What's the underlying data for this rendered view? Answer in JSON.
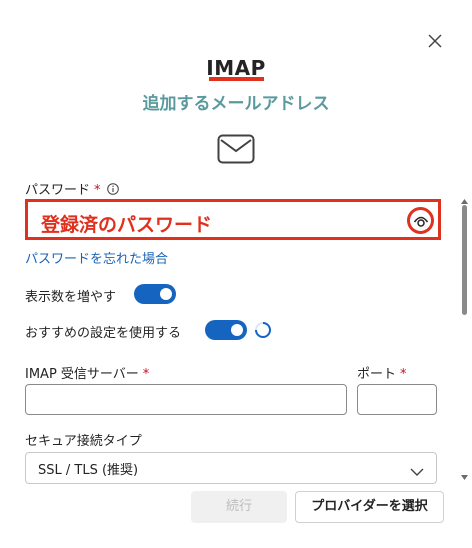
{
  "dialog": {
    "title": "IMAP",
    "subtitle": "追加するメールアドレス"
  },
  "password": {
    "label": "パスワード",
    "required_mark": "*",
    "value": "登録済のパスワード",
    "forgot_link": "パスワードを忘れた場合"
  },
  "toggles": {
    "show_more": {
      "label": "表示数を増やす",
      "on": true
    },
    "recommended": {
      "label": "おすすめの設定を使用する",
      "on": true
    }
  },
  "server": {
    "imap_label": "IMAP 受信サーバー",
    "imap_value": "",
    "port_label": "ポート",
    "port_value": "",
    "required_mark": "*"
  },
  "security": {
    "label": "セキュア接続タイプ",
    "value": "SSL / TLS (推奨)"
  },
  "footer": {
    "continue_label": "続行",
    "select_provider_label": "プロバイダーを選択"
  },
  "icons": {
    "close": "close-icon",
    "mail": "mail-icon",
    "info": "info-icon",
    "eye": "eye-icon",
    "chevron": "chevron-down-icon",
    "spinner": "spinner-icon"
  },
  "colors": {
    "accent": "#1565c0",
    "highlight": "#e0301e",
    "subtitle": "#5a9a9e",
    "link": "#1a63b4"
  }
}
